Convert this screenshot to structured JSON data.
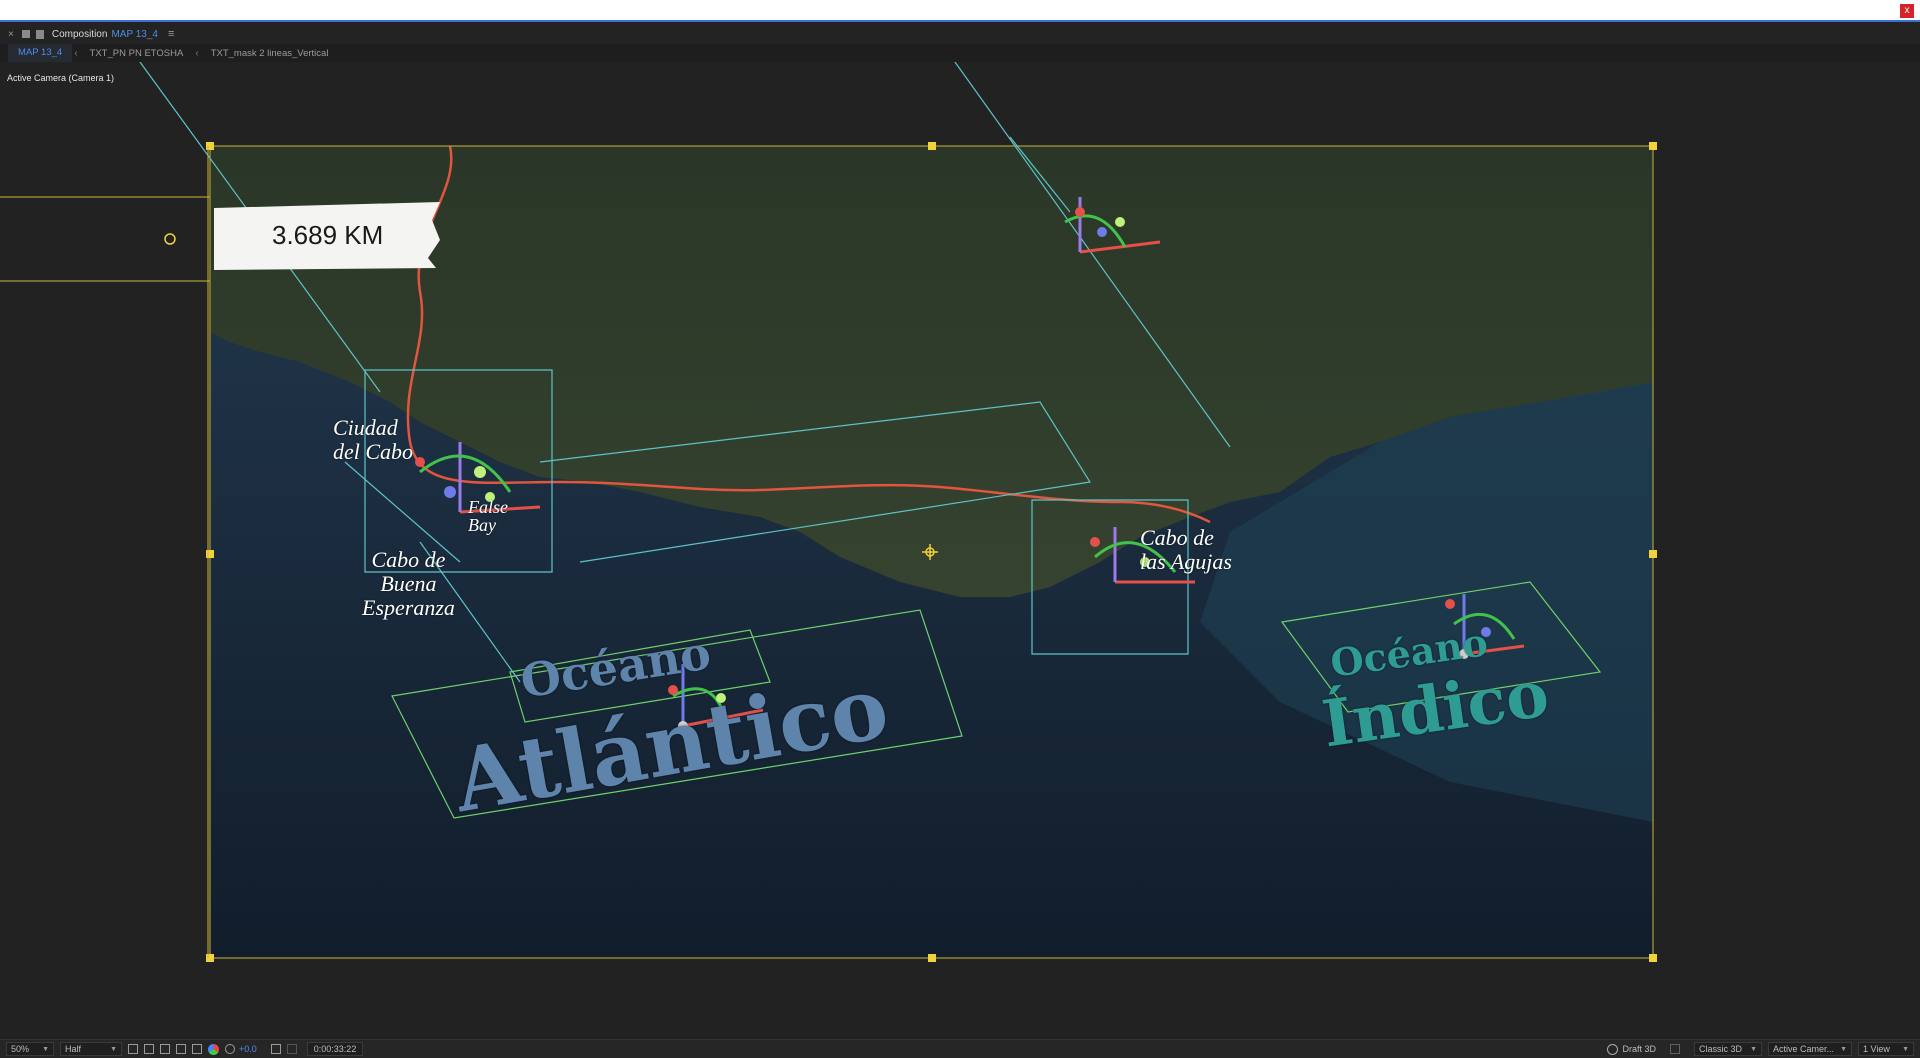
{
  "window": {
    "close_label": "x"
  },
  "panel": {
    "close_label": "×",
    "comp_prefix": "Composition",
    "comp_name": "MAP 13_4",
    "menu_icon": "menu-icon"
  },
  "tabs": [
    {
      "label": "MAP 13_4",
      "active": true
    },
    {
      "label": "TXT_PN PN ETOSHA",
      "active": false
    },
    {
      "label": "TXT_mask 2 lineas_Vertical",
      "active": false
    }
  ],
  "viewer": {
    "camera_label": "Active Camera (Camera 1)",
    "distance_text": "3.689 KM",
    "labels": {
      "ciudad": "Ciudad\ndel Cabo",
      "false_bay": "False\nBay",
      "cabo_buena": "Cabo de\nBuena\nEsperanza",
      "cabo_agujas": "Cabo de\nlas Agujas",
      "oceano_atl": "Océano",
      "atlantico": "Atlántico",
      "oceano_ind": "Océano",
      "indico": "Índico"
    },
    "colors": {
      "land": "#2f3b2a",
      "ocean": "#1a2a3b",
      "route": "#e0563e",
      "guide": "#5ec3c8",
      "handle": "#f2d23a",
      "ocean_text_atl": "#5f84ab",
      "ocean_text_ind": "#2f9c93"
    }
  },
  "bottom": {
    "zoom": "50%",
    "resolution": "Half",
    "exposure": "+0.0",
    "timecode": "0:00:33:22",
    "renderer_draft": "Draft 3D",
    "renderer": "Classic 3D",
    "view": "Active Camer...",
    "layout": "1 View"
  }
}
